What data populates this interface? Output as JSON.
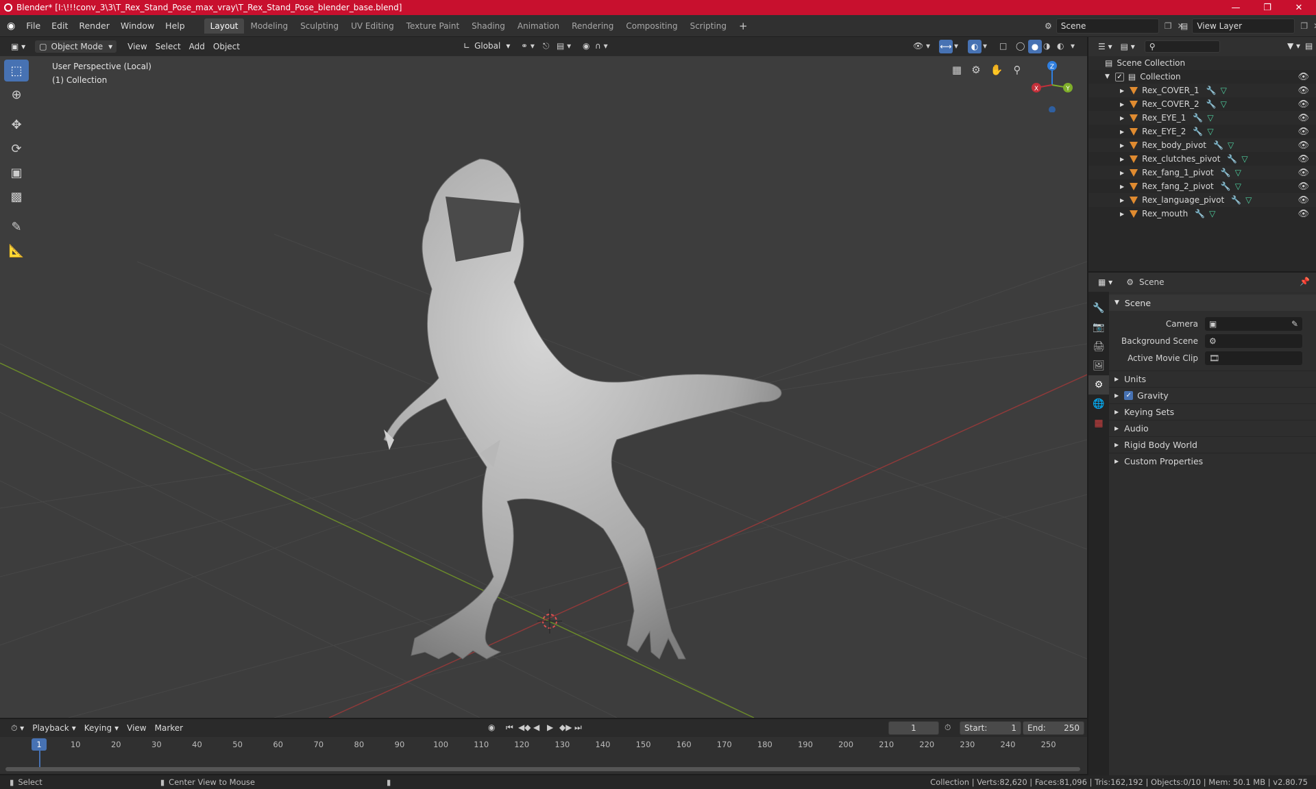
{
  "window": {
    "title": "Blender* [I:\\!!!conv_3\\3\\T_Rex_Stand_Pose_max_vray\\T_Rex_Stand_Pose_blender_base.blend]",
    "controls": [
      "minimize-icon",
      "maximize-icon",
      "close-icon"
    ]
  },
  "menu": [
    "File",
    "Edit",
    "Render",
    "Window",
    "Help"
  ],
  "workspaces": [
    "Layout",
    "Modeling",
    "Sculpting",
    "UV Editing",
    "Texture Paint",
    "Shading",
    "Animation",
    "Rendering",
    "Compositing",
    "Scripting"
  ],
  "active_workspace": "Layout",
  "scene_field": "Scene",
  "view_layer_field": "View Layer",
  "viewport_header": {
    "mode": "Object Mode",
    "menus": [
      "View",
      "Select",
      "Add",
      "Object"
    ],
    "orientation": "Global"
  },
  "viewport": {
    "perspective_label": "User Perspective (Local)",
    "collection_label": "(1) Collection",
    "gizmo_axes": {
      "x": "X",
      "y": "Y",
      "z": "Z"
    }
  },
  "outliner": {
    "root": "Scene Collection",
    "collection": "Collection",
    "items": [
      "Rex_COVER_1",
      "Rex_COVER_2",
      "Rex_EYE_1",
      "Rex_EYE_2",
      "Rex_body_pivot",
      "Rex_clutches_pivot",
      "Rex_fang_1_pivot",
      "Rex_fang_2_pivot",
      "Rex_language_pivot",
      "Rex_mouth"
    ]
  },
  "properties": {
    "header": "Scene",
    "panel": "Scene",
    "rows": [
      {
        "label": "Camera",
        "value": ""
      },
      {
        "label": "Background Scene",
        "value": ""
      },
      {
        "label": "Active Movie Clip",
        "value": ""
      }
    ],
    "subpanels": [
      "Units",
      "Gravity",
      "Keying Sets",
      "Audio",
      "Rigid Body World",
      "Custom Properties"
    ],
    "gravity_checked": true
  },
  "timeline": {
    "menus": [
      "Playback",
      "Keying",
      "View",
      "Marker"
    ],
    "current_frame": "1",
    "start_label": "Start:",
    "start": "1",
    "end_label": "End:",
    "end": "250",
    "ruler": [
      "1",
      "10",
      "20",
      "30",
      "40",
      "50",
      "60",
      "70",
      "80",
      "90",
      "100",
      "110",
      "120",
      "130",
      "140",
      "150",
      "160",
      "170",
      "180",
      "190",
      "200",
      "210",
      "220",
      "230",
      "240",
      "250"
    ]
  },
  "status": {
    "left": "Select",
    "middle": "Center View to Mouse",
    "right": "Collection | Verts:82,620 | Faces:81,096 | Tris:162,192 | Objects:0/10 | Mem: 50.1 MB | v2.80.75"
  },
  "colors": {
    "accent": "#4772b3",
    "titlebar": "#c8102e",
    "x_axis": "#c3303a",
    "y_axis": "#7fae2a",
    "z_axis": "#2f7fe0"
  }
}
